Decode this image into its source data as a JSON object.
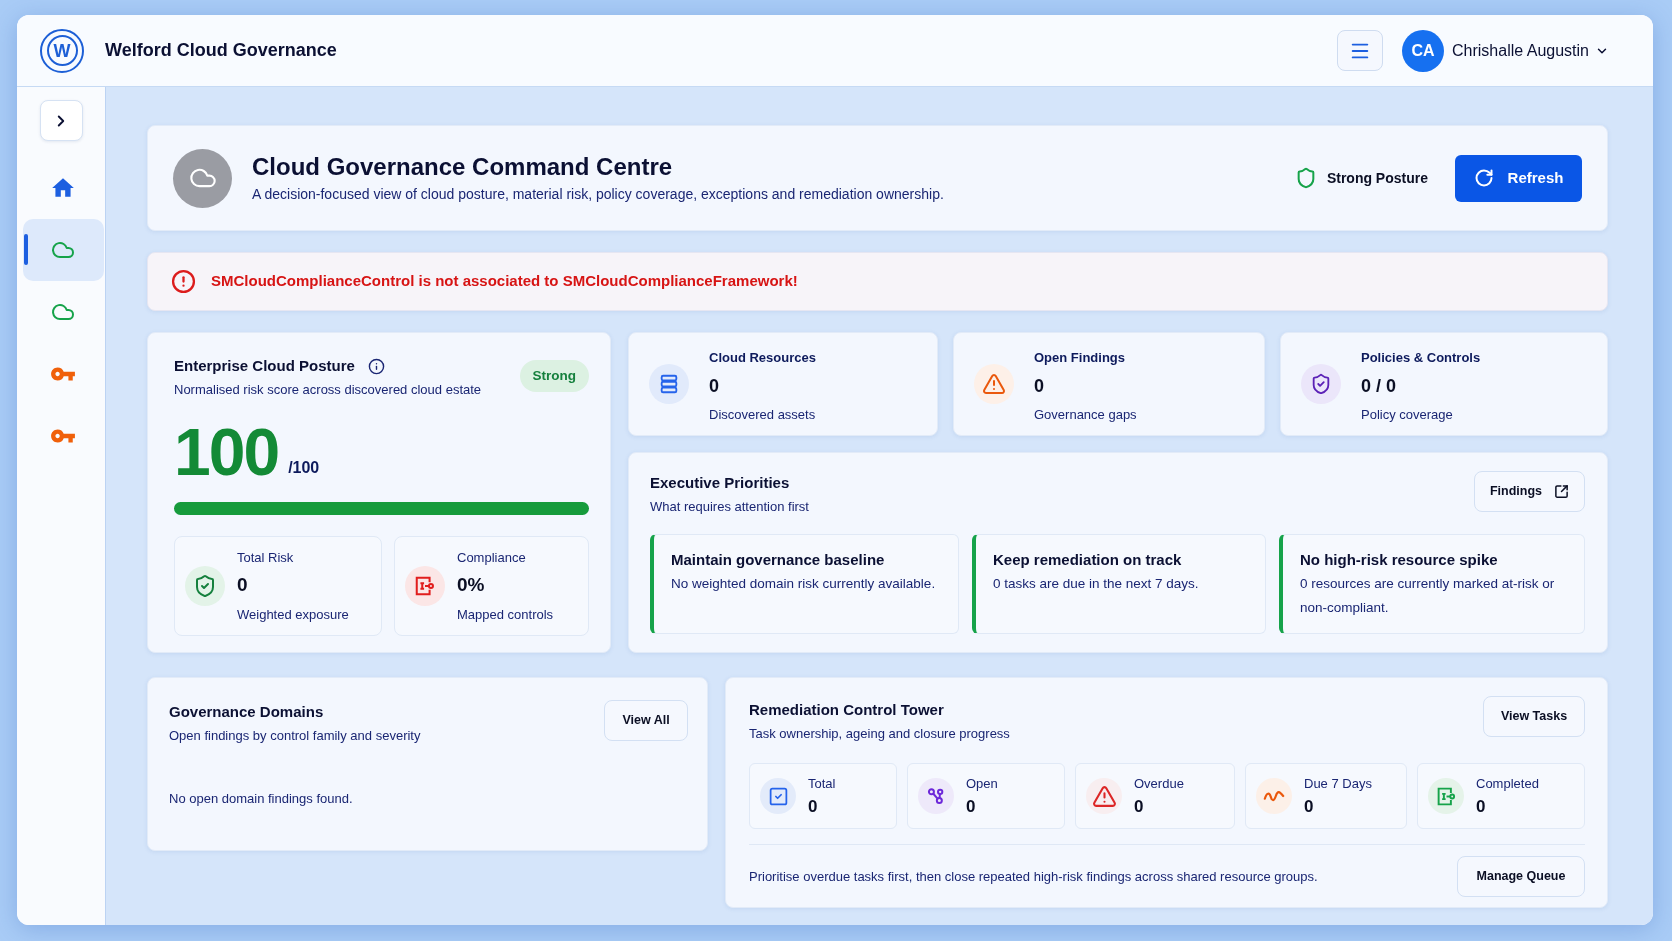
{
  "app": {
    "logo_letter": "W",
    "title": "Welford Cloud Governance"
  },
  "user": {
    "initials": "CA",
    "name": "Chrishalle Augustin"
  },
  "sidebar": {
    "items": [
      {
        "kind": "home",
        "selected": false
      },
      {
        "kind": "cloud",
        "selected": true
      },
      {
        "kind": "cloud",
        "selected": false
      },
      {
        "kind": "key",
        "selected": false
      },
      {
        "kind": "key",
        "selected": false
      }
    ]
  },
  "page_header": {
    "title": "Cloud Governance Command Centre",
    "subtitle": "A decision-focused view of cloud posture, material risk, policy coverage, exceptions and remediation ownership.",
    "posture_label": "Strong Posture",
    "refresh_button": "Refresh"
  },
  "alert": {
    "message": "SMCloudComplianceControl is not associated to SMCloudComplianceFramework!"
  },
  "posture": {
    "title": "Enterprise Cloud Posture",
    "subtitle": "Normalised risk score across discovered cloud estate",
    "badge": "Strong",
    "score": "100",
    "max": "/100",
    "level": 1,
    "metrics": [
      {
        "kind": "risk",
        "label": "Total Risk",
        "value": "0",
        "caption": "Weighted exposure"
      },
      {
        "kind": "compliance",
        "label": "Compliance",
        "value": "0%",
        "caption": "Mapped controls"
      }
    ]
  },
  "stats": [
    {
      "kind": "resources",
      "label": "Cloud Resources",
      "value": "0",
      "caption": "Discovered assets"
    },
    {
      "kind": "findings",
      "label": "Open Findings",
      "value": "0",
      "caption": "Governance gaps"
    },
    {
      "kind": "policies",
      "label": "Policies & Controls",
      "value": "0 / 0",
      "caption": "Policy coverage"
    }
  ],
  "priorities": {
    "title": "Executive Priorities",
    "subtitle": "What requires attention first",
    "button": "Findings",
    "items": [
      {
        "title": "Maintain governance baseline",
        "text": "No weighted domain risk currently available."
      },
      {
        "title": "Keep remediation on track",
        "text": "0 tasks are due in the next 7 days."
      },
      {
        "title": "No high-risk resource spike",
        "text": "0 resources are currently marked at-risk or non-compliant."
      }
    ]
  },
  "domains": {
    "title": "Governance Domains",
    "subtitle": "Open findings by control family and severity",
    "button": "View All",
    "empty_text": "No open domain findings found."
  },
  "remediation": {
    "title": "Remediation Control Tower",
    "subtitle": "Task ownership, ageing and closure progress",
    "button": "View Tasks",
    "stats": [
      {
        "kind": "total",
        "label": "Total",
        "value": "0"
      },
      {
        "kind": "open",
        "label": "Open",
        "value": "0"
      },
      {
        "kind": "overdue",
        "label": "Overdue",
        "value": "0"
      },
      {
        "kind": "due",
        "label": "Due 7 Days",
        "value": "0"
      },
      {
        "kind": "completed",
        "label": "Completed",
        "value": "0"
      }
    ],
    "note": "Prioritise overdue tasks first, then close repeated high-risk findings across shared resource groups.",
    "action_button": "Manage Queue"
  }
}
